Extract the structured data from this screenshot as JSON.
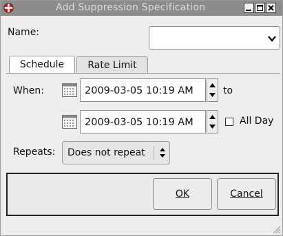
{
  "window": {
    "title": "Add Suppression Specification"
  },
  "name_label": "Name:",
  "name_value": "",
  "tabs": [
    {
      "label": "Schedule"
    },
    {
      "label": "Rate Limit"
    }
  ],
  "when_label": "When:",
  "start_datetime": "2009-03-05 10:19 AM",
  "to_label": "to",
  "end_datetime": "2009-03-05 10:19 AM",
  "all_day_label": "All Day",
  "all_day_checked": false,
  "repeats_label": "Repeats:",
  "repeats_value": "Does not repeat",
  "buttons": {
    "ok": "OK",
    "cancel": "Cancel"
  }
}
